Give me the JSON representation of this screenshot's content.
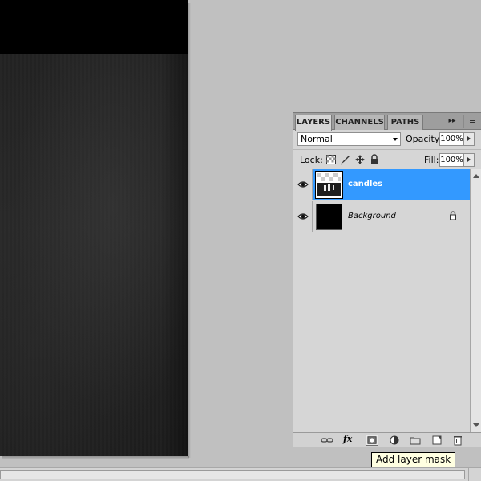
{
  "panel": {
    "tabs": [
      {
        "label": "LAYERS",
        "active": true
      },
      {
        "label": "CHANNELS",
        "active": false
      },
      {
        "label": "PATHS",
        "active": false
      }
    ],
    "tab_overflow": "▸▸",
    "tab_menu": "≡",
    "blend_mode": "Normal",
    "opacity_label": "Opacity:",
    "opacity_value": "100%",
    "lock_label": "Lock:",
    "fill_label": "Fill:",
    "fill_value": "100%",
    "layers": [
      {
        "name": "candles",
        "selected": true,
        "visible": true,
        "locked": false
      },
      {
        "name": "Background",
        "selected": false,
        "visible": true,
        "locked": true
      }
    ],
    "bottom_fx_label": "fx"
  },
  "tooltip": {
    "text": "Add layer mask"
  },
  "colors": {
    "selection": "#3399ff",
    "panel_bg": "#d6d6d6",
    "workspace_bg": "#c0c0c0",
    "tooltip_bg": "#ffffe1"
  }
}
